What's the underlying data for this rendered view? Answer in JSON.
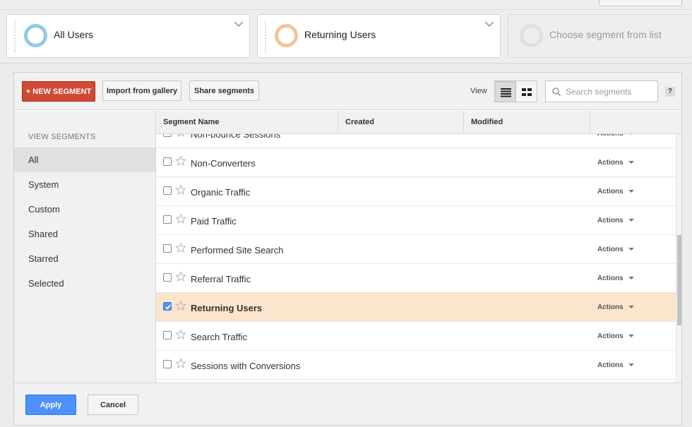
{
  "segment_bar": {
    "cards": [
      {
        "label": "All Users",
        "ring_color": "#8ecae6"
      },
      {
        "label": "Returning Users",
        "ring_color": "#f3c49a"
      },
      {
        "label": "Choose segment from list",
        "ring_color": "#e0e0e0"
      }
    ]
  },
  "toolbar": {
    "new_segment_label": "+ NEW SEGMENT",
    "import_label": "Import from gallery",
    "share_label": "Share segments",
    "view_label": "View",
    "search_placeholder": "Search segments",
    "help_label": "?"
  },
  "sidebar": {
    "heading": "VIEW SEGMENTS",
    "items": [
      {
        "label": "All",
        "active": true
      },
      {
        "label": "System"
      },
      {
        "label": "Custom"
      },
      {
        "label": "Shared"
      },
      {
        "label": "Starred"
      },
      {
        "label": "Selected"
      }
    ]
  },
  "table": {
    "columns": [
      "Segment Name",
      "Created",
      "Modified"
    ],
    "actions_label": "Actions",
    "rows": [
      {
        "name": "Non-bounce Sessions",
        "checked": false
      },
      {
        "name": "Non-Converters",
        "checked": false
      },
      {
        "name": "Organic Traffic",
        "checked": false
      },
      {
        "name": "Paid Traffic",
        "checked": false
      },
      {
        "name": "Performed Site Search",
        "checked": false
      },
      {
        "name": "Referral Traffic",
        "checked": false
      },
      {
        "name": "Returning Users",
        "checked": true
      },
      {
        "name": "Search Traffic",
        "checked": false
      },
      {
        "name": "Sessions with Conversions",
        "checked": false
      }
    ]
  },
  "footer": {
    "apply_label": "Apply",
    "cancel_label": "Cancel"
  },
  "colors": {
    "new_segment_red": "#d14836",
    "apply_blue": "#4d90fe",
    "selected_row": "#fce5cd"
  }
}
